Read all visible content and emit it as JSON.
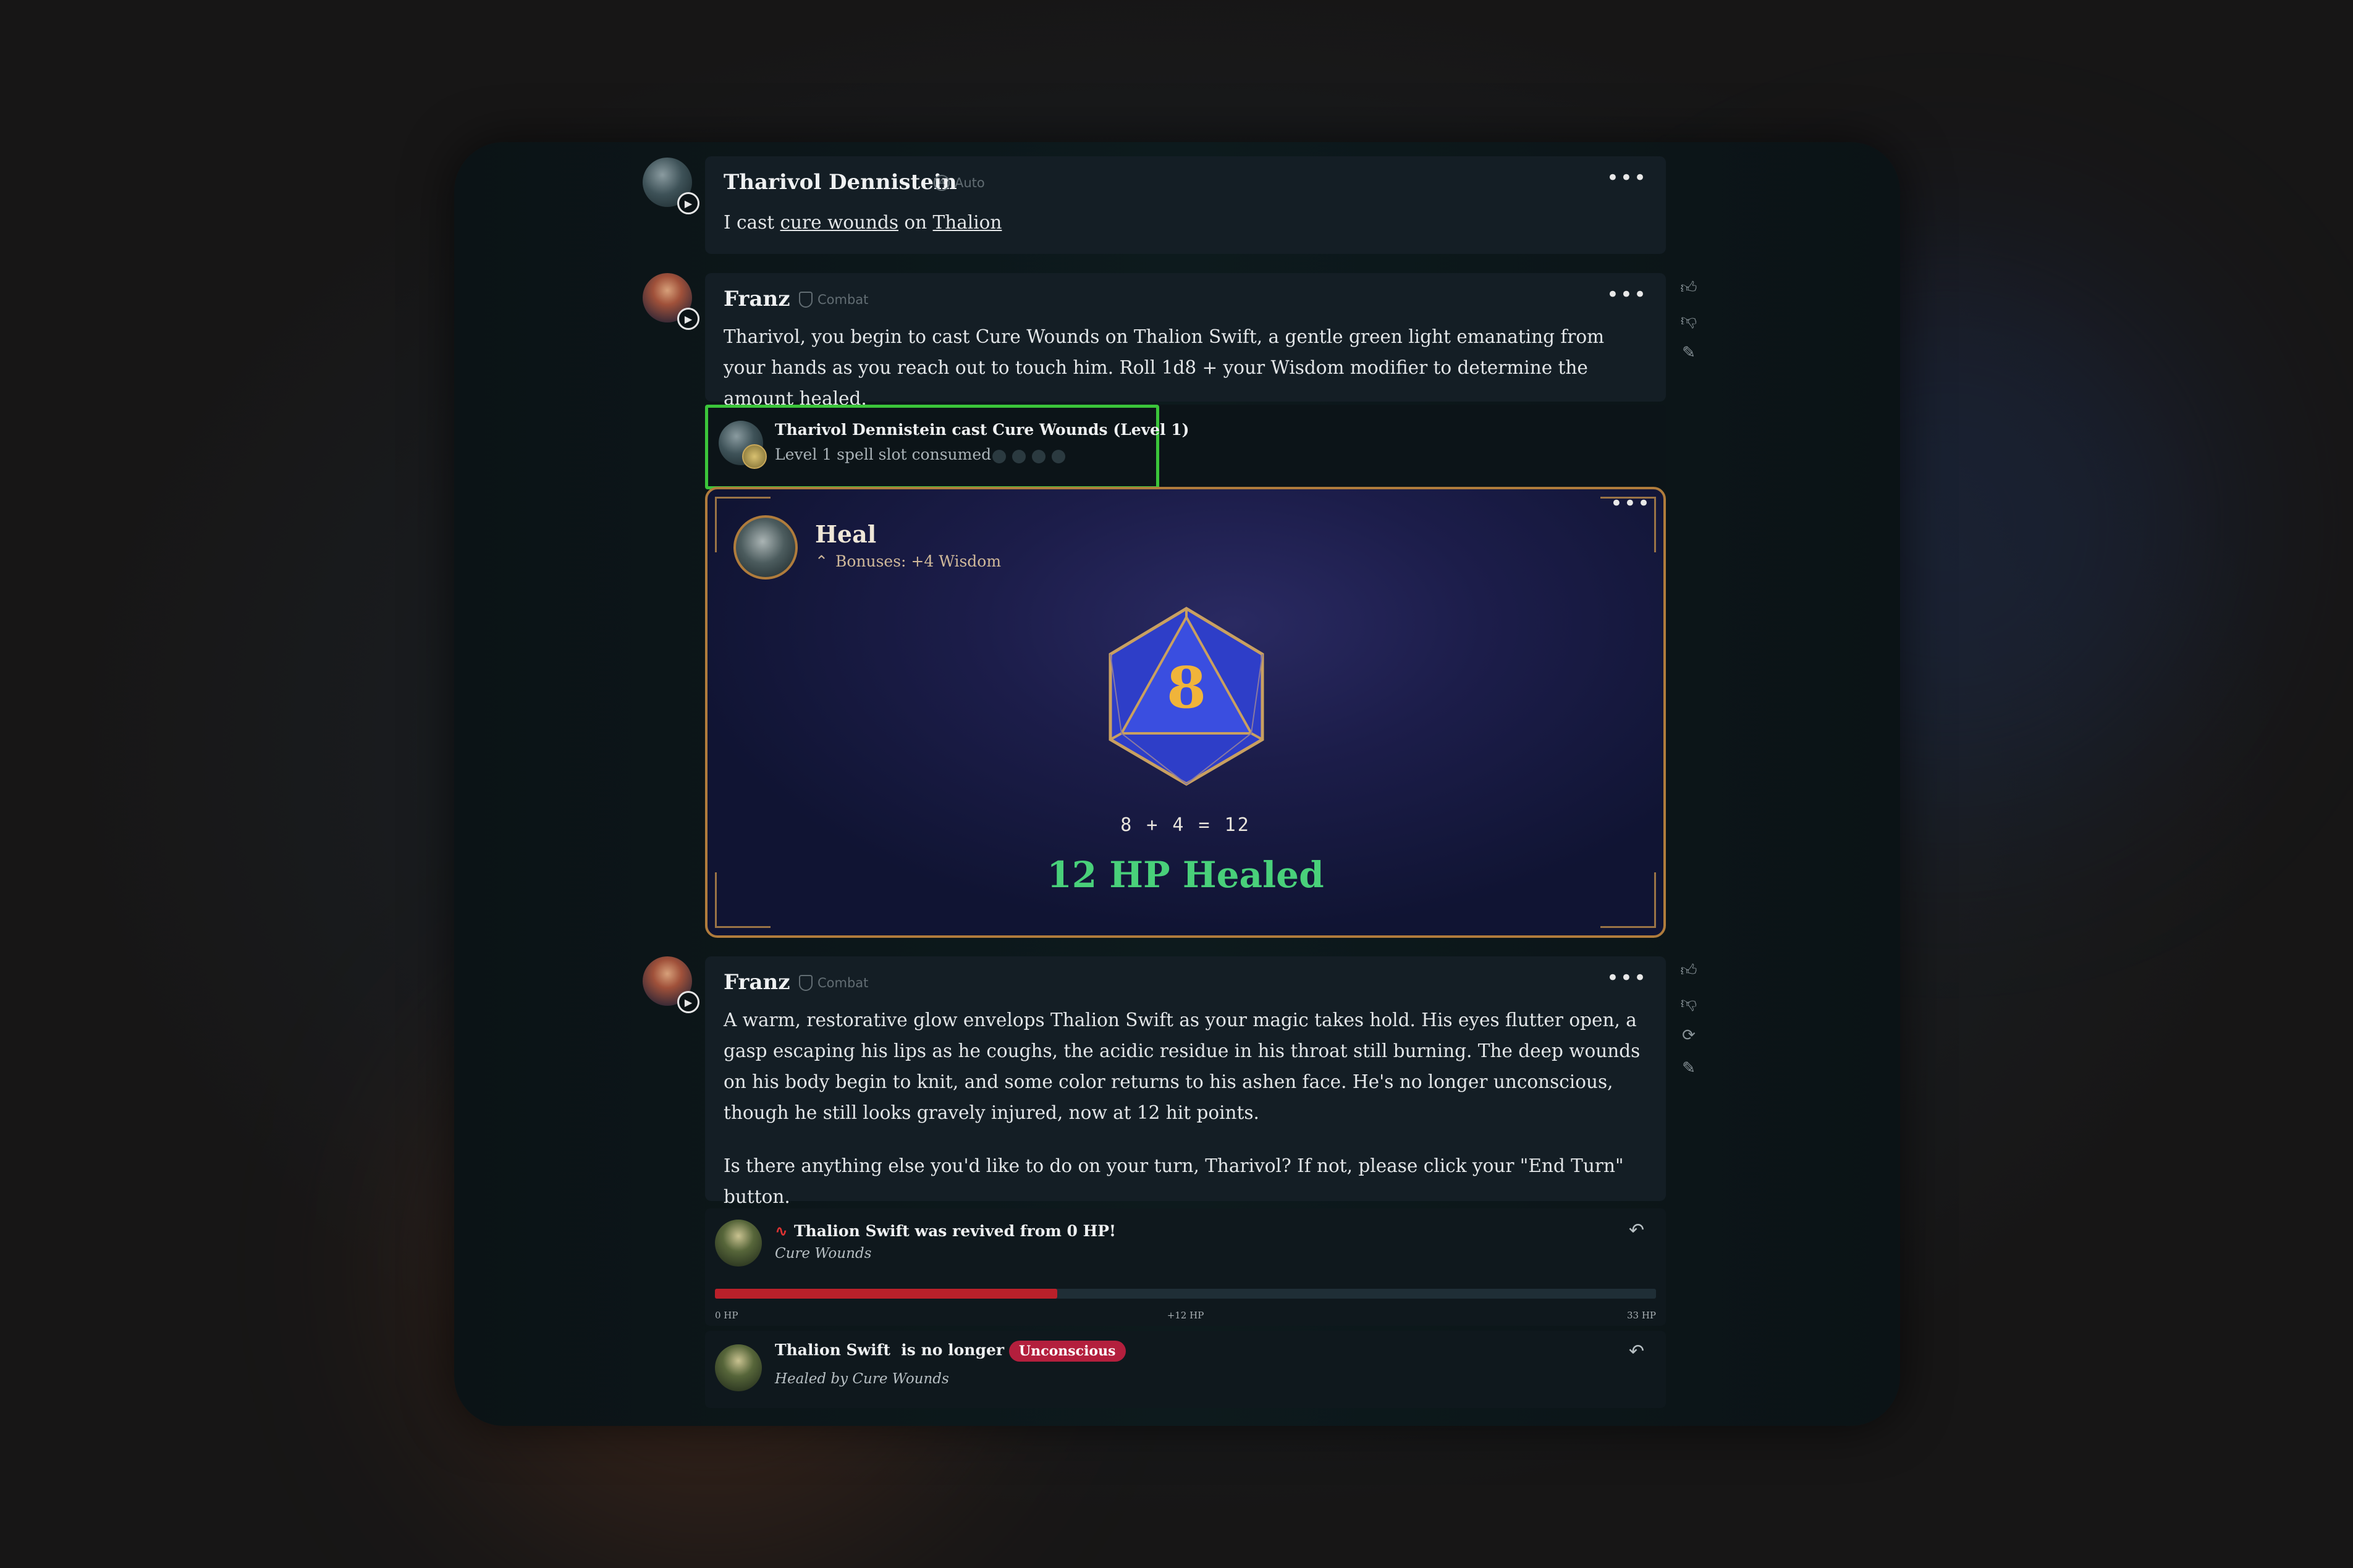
{
  "messages": [
    {
      "name": "Tharivol Dennistein",
      "tag": "Auto",
      "text_prefix": "I cast ",
      "link1": "cure wounds",
      "text_mid": " on ",
      "link2": "Thalion"
    },
    {
      "name": "Franz",
      "tag": "Combat",
      "text": "Tharivol, you begin to cast Cure Wounds on Thalion Swift, a gentle green light emanating from your hands as you reach out to touch him. Roll 1d8 + your Wisdom modifier to determine the amount healed."
    },
    {
      "name": "Franz",
      "tag": "Combat",
      "text": "A warm, restorative glow envelops Thalion Swift as your magic takes hold. His eyes flutter open, a gasp escaping his lips as he coughs, the acidic residue in his throat still burning. The deep wounds on his body begin to knit, and some color returns to his ashen face. He's no longer unconscious, though he still looks gravely injured, now at 12 hit points.",
      "text2": "Is there anything else you'd like to do on your turn, Tharivol? If not, please click your \"End Turn\" button."
    }
  ],
  "spell": {
    "title": "Tharivol Dennistein cast Cure Wounds (Level 1)",
    "subtitle": "Level 1 spell slot consumed",
    "slots_total": 4
  },
  "heal": {
    "title": "Heal",
    "bonus": "Bonuses: +4 Wisdom",
    "die": "8",
    "equation": "8 + 4 = 12",
    "result": "12 HP Healed"
  },
  "revive": {
    "title": "Thalion Swift was revived from 0 HP!",
    "subtitle": "Cure Wounds",
    "hp_min": "0 HP",
    "hp_gain": "+12 HP",
    "hp_max": "33 HP",
    "hp_fraction": 0.364
  },
  "condition": {
    "title": "Thalion Swift  is no longer",
    "badge": "Unconscious",
    "subtitle": "Healed by Cure Wounds"
  },
  "icons": {
    "more": "more-icon",
    "thumbs_up": "thumbs-up-icon",
    "thumbs_down": "thumbs-down-icon",
    "edit": "edit-icon",
    "regenerate": "regenerate-icon",
    "undo": "undo-icon",
    "play": "play-icon",
    "pulse": "pulse-icon"
  },
  "colors": {
    "accent_green": "#3bc53a",
    "heal_green": "#49d07a",
    "hp_red": "#b9202a",
    "badge_red": "#b31f3d",
    "card_border": "#b07c3c",
    "die_blue": "#2e3ec8",
    "die_gold": "#f0b43a"
  }
}
